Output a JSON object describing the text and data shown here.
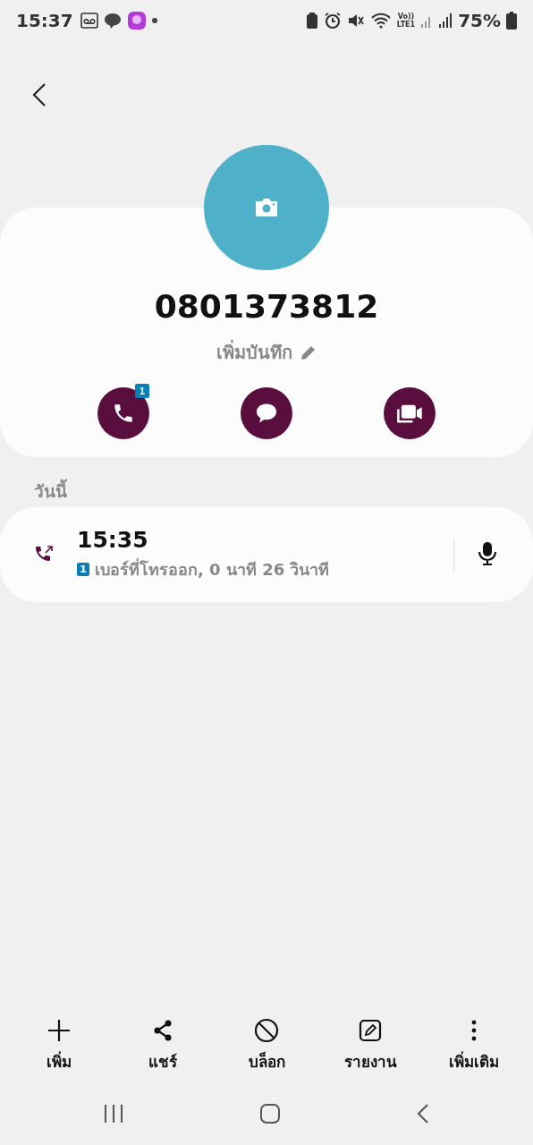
{
  "status_bar": {
    "time": "15:37",
    "battery": "75%",
    "signal_label": "Vo))\nLTE1"
  },
  "contact": {
    "number": "0801373812",
    "note": "เพิ่มบันทึก",
    "actions": [
      {
        "kind": "call",
        "badge": "1"
      },
      {
        "kind": "message"
      },
      {
        "kind": "video"
      }
    ]
  },
  "history": {
    "heading": "วันนี้",
    "calls": [
      {
        "time": "15:35",
        "sim": "1",
        "detail": "เบอร์ที่โทรออก, 0 นาที 26 วินาที"
      }
    ]
  },
  "bottom_actions": [
    {
      "kind": "add",
      "label": "เพิ่ม"
    },
    {
      "kind": "share",
      "label": "แชร์"
    },
    {
      "kind": "block",
      "label": "บล็อก"
    },
    {
      "kind": "report",
      "label": "รายงาน"
    },
    {
      "kind": "more",
      "label": "เพิ่มเติม"
    }
  ]
}
